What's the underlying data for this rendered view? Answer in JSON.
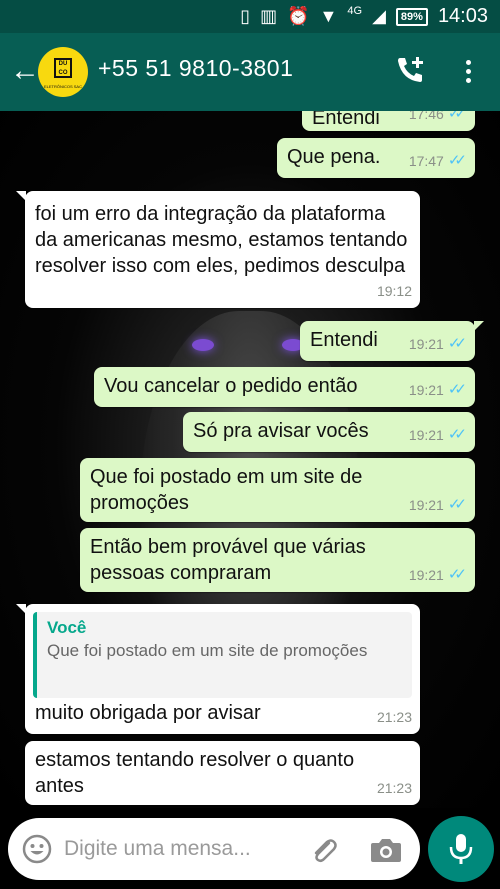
{
  "status_bar": {
    "network": "4G",
    "battery": "89%",
    "time": "14:03"
  },
  "header": {
    "contact": "+55 51 9810-3801",
    "avatar_text": "DU CO",
    "avatar_subtext": "ELETRÔNICOS SAC"
  },
  "messages": [
    {
      "text": "Entendi",
      "time": "17:46"
    },
    {
      "text": "Que pena.",
      "time": "17:47"
    },
    {
      "text": "foi um erro da integração da plataforma da americanas mesmo, estamos tentando resolver isso com eles, pedimos desculpa",
      "time": "19:12"
    },
    {
      "text": "Entendi",
      "time": "19:21"
    },
    {
      "text": "Vou cancelar o pedido então",
      "time": "19:21"
    },
    {
      "text": "Só pra avisar vocês",
      "time": "19:21"
    },
    {
      "text": "Que foi postado em um site de promoções",
      "time": "19:21"
    },
    {
      "text": "Então bem provável que várias pessoas compraram",
      "time": "19:21"
    },
    {
      "quote_name": "Você",
      "quote_text": "Que foi postado em um site de promoções",
      "text": "muito obrigada por avisar",
      "time": "21:23"
    },
    {
      "text": "estamos tentando resolver o quanto antes",
      "time": "21:23"
    }
  ],
  "input": {
    "placeholder": "Digite uma mensa..."
  },
  "colors": {
    "header": "#075e54",
    "outgoing": "#dcf8c6",
    "incoming": "#ffffff",
    "ticks": "#4fc3f7",
    "fab": "#00897b"
  },
  "icons": [
    "back-arrow-icon",
    "add-call-icon",
    "more-menu-icon",
    "emoji-icon",
    "attach-clip-icon",
    "camera-icon",
    "mic-icon",
    "read-ticks-icon"
  ]
}
